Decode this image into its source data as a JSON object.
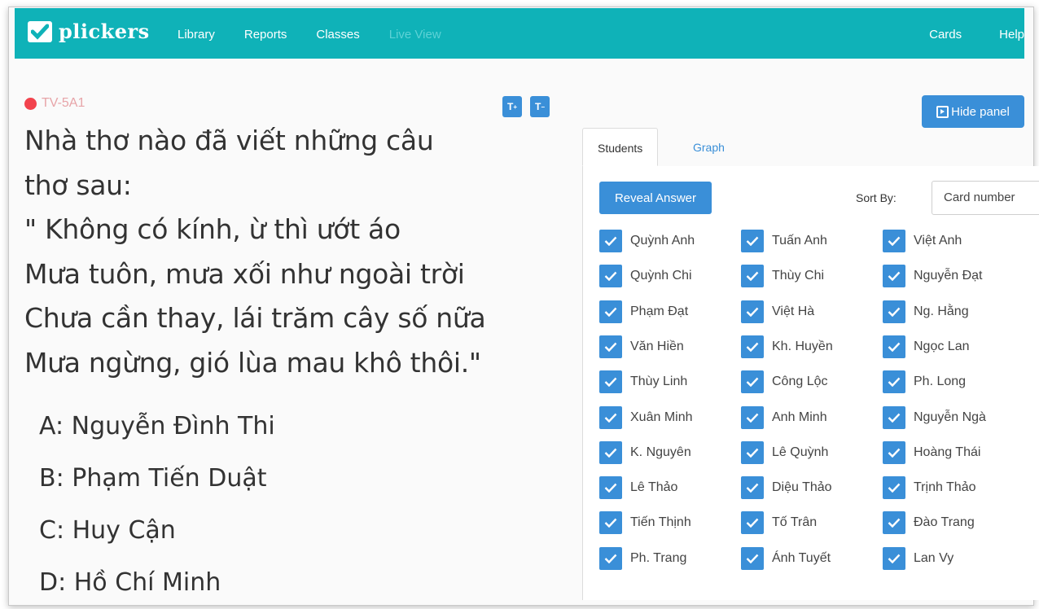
{
  "brand": {
    "name": "plickers"
  },
  "nav": {
    "links": [
      "Library",
      "Reports",
      "Classes",
      "Live View"
    ],
    "right": [
      "Cards",
      "Help"
    ]
  },
  "class": {
    "name": "TV-5A1"
  },
  "font_controls": {
    "increase": "T",
    "decrease": "T"
  },
  "question": {
    "text": "Nhà thơ nào đã viết những câu\nthơ sau:\n\" Không có kính, ừ thì ướt áo\nMưa tuôn, mưa xối như ngoài trời\nChưa cần thay, lái trăm cây số nữa\nMưa ngừng, gió lùa mau khô thôi.\"",
    "answers": [
      "A: Nguyễn Đình Thi",
      "B: Phạm Tiến Duật",
      "C: Huy Cận",
      "D: Hồ Chí Minh"
    ]
  },
  "panel": {
    "hide_label": "Hide panel",
    "tabs": [
      "Students",
      "Graph"
    ],
    "reveal_label": "Reveal Answer",
    "sort_label": "Sort By:",
    "sort_value": "Card number",
    "students": [
      [
        "Quỳnh Anh",
        "Tuấn Anh",
        "Việt Anh"
      ],
      [
        "Quỳnh Chi",
        "Thùy Chi",
        "Nguyễn Đạt"
      ],
      [
        "Phạm Đạt",
        "Việt Hà",
        "Ng. Hằng"
      ],
      [
        "Văn Hiền",
        "Kh. Huyền",
        "Ngọc Lan"
      ],
      [
        "Thùy Linh",
        "Công Lộc",
        "Ph. Long"
      ],
      [
        "Xuân Minh",
        "Anh Minh",
        "Nguyễn Ngà"
      ],
      [
        "K. Nguyên",
        "Lê Quỳnh",
        "Hoàng Thái"
      ],
      [
        "Lê Thảo",
        "Diệu Thảo",
        "Trịnh Thảo"
      ],
      [
        "Tiến Thịnh",
        "Tố Trân",
        "Đào Trang"
      ],
      [
        "Ph. Trang",
        "Ánh Tuyết",
        "Lan Vy"
      ]
    ]
  },
  "colors": {
    "teal": "#0fb2b8",
    "blue": "#3a8fd8",
    "red": "#f2434d"
  }
}
